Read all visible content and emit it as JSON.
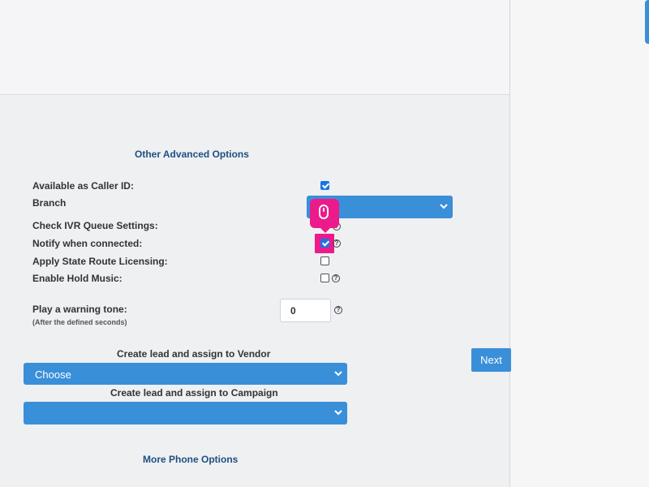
{
  "section_titles": {
    "other_advanced": "Other Advanced Options",
    "more_phone": "More Phone Options"
  },
  "fields": {
    "caller_id": {
      "label": "Available as Caller ID:",
      "checked": true
    },
    "branch": {
      "label": "Branch",
      "value": ""
    },
    "ivr_queue": {
      "label": "Check IVR Queue Settings:"
    },
    "notify_connected": {
      "label": "Notify when connected:",
      "checked": true
    },
    "state_route": {
      "label": "Apply State Route Licensing:",
      "checked": false
    },
    "hold_music": {
      "label": "Enable Hold Music:",
      "checked": false
    },
    "warning_tone": {
      "label": "Play a warning tone:",
      "sublabel": "(After the defined seconds)",
      "value": "0"
    }
  },
  "vendor": {
    "label": "Create lead and assign to Vendor",
    "value": "Choose"
  },
  "campaign": {
    "label": "Create lead and assign to Campaign",
    "value": ""
  },
  "help_symbol": "?",
  "buttons": {
    "next": "Next"
  },
  "colors": {
    "accent": "#3a8fd9",
    "title": "#1f4f82",
    "highlight": "#ec1a8a"
  },
  "icons": {
    "help": "question-circle-icon",
    "chevron": "chevron-down-icon",
    "cursor": "mouse-icon"
  }
}
